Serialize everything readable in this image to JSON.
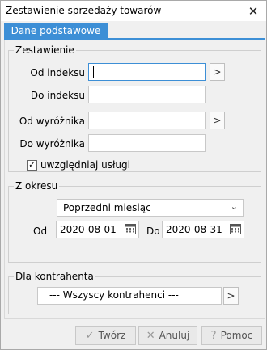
{
  "window": {
    "title": "Zestawienie sprzedaży towarów",
    "close_glyph": "✕"
  },
  "tabs": [
    {
      "label": "Dane podstawowe",
      "active": true
    }
  ],
  "zestawienie": {
    "legend": "Zestawienie",
    "od_indeksu": {
      "label": "Od indeksu",
      "value": ""
    },
    "do_indeksu": {
      "label": "Do indeksu",
      "value": ""
    },
    "od_wyroznika": {
      "label": "Od wyróżnika",
      "value": ""
    },
    "do_wyroznika": {
      "label": "Do wyróżnika",
      "value": ""
    },
    "uwzgledniaj_uslugi": {
      "label": "uwzględniaj usługi",
      "checked": true
    }
  },
  "okres": {
    "legend": "Z okresu",
    "select_value": "Poprzedni miesiąc",
    "od_label": "Od",
    "od_value": "2020-08-01",
    "do_label": "Do",
    "do_value": "2020-08-31"
  },
  "kontrahent": {
    "legend": "Dla kontrahenta",
    "value": "--- Wszyscy kontrahenci ---"
  },
  "buttons": {
    "tworz": {
      "label": "Twórz",
      "icon": "check-icon"
    },
    "anuluj": {
      "label": "Anuluj",
      "icon": "close-icon"
    },
    "pomoc": {
      "label": "Pomoc",
      "icon": "help-icon"
    }
  },
  "accent_color": "#3d8fd6"
}
